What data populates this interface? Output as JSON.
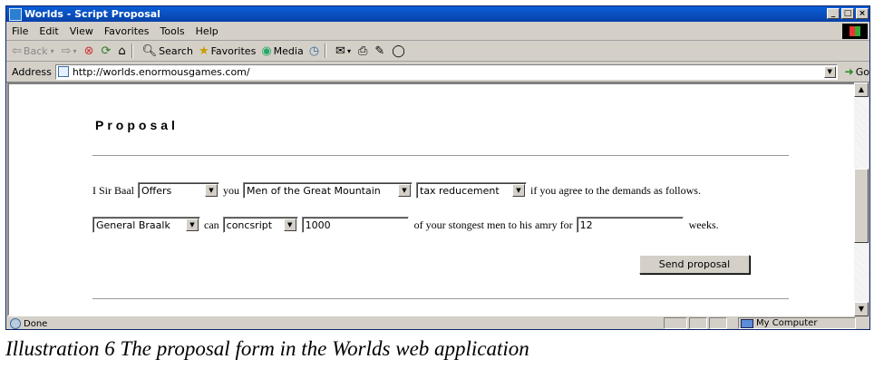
{
  "window": {
    "title": "Worlds - Script Proposal",
    "buttons": [
      "_",
      "□",
      "×"
    ]
  },
  "menu": [
    "File",
    "Edit",
    "View",
    "Favorites",
    "Tools",
    "Help"
  ],
  "toolbar": {
    "back": "Back",
    "search": "Search",
    "favorites": "Favorites",
    "media": "Media"
  },
  "address": {
    "label": "Address",
    "url": "http://worlds.enormousgames.com/",
    "go": "Go"
  },
  "page": {
    "heading": "Proposal",
    "line1": {
      "prefix": "I Sir Baal",
      "action": "Offers",
      "word_you": "you",
      "target": "Men of the Great Mountain",
      "offer": "tax reducement",
      "suffix": "if you agree to the demands as follows."
    },
    "line2": {
      "who": "General Braalk",
      "word_can": "can",
      "verb": "concsript",
      "amount": "1000",
      "middle": "of your stongest men to his amry for",
      "duration": "12",
      "suffix": "weeks."
    },
    "send_button": "Send proposal"
  },
  "status": {
    "text": "Done",
    "zone": "My Computer"
  },
  "caption": "Illustration 6 The proposal form in the Worlds web application"
}
